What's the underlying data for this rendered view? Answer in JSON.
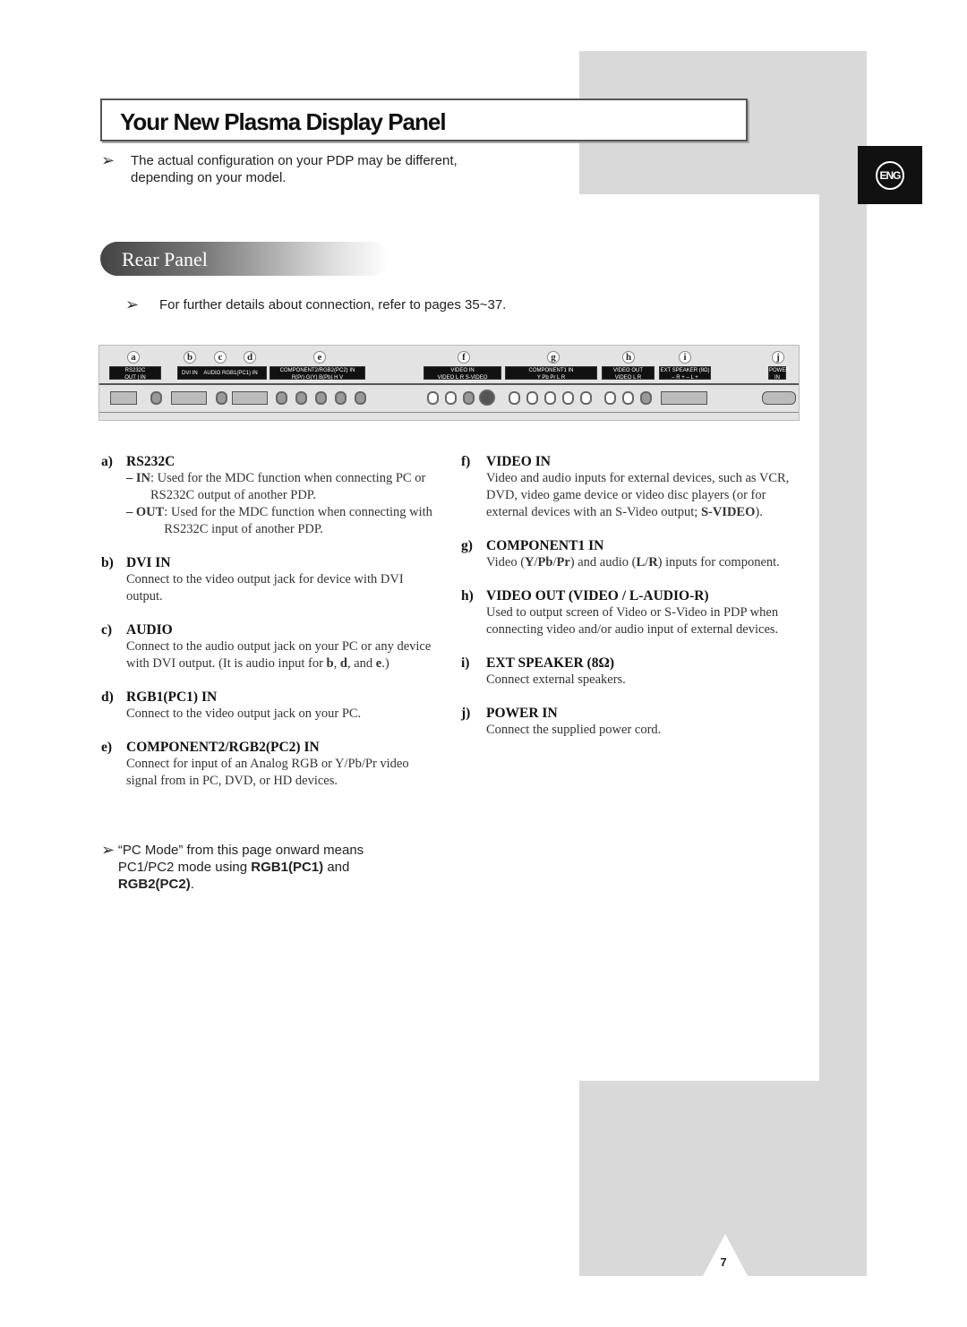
{
  "header": {
    "title": "Your New Plasma Display Panel",
    "lang_tab": "ENG"
  },
  "note_top": "The actual configuration on your PDP may be different, depending on your model.",
  "section": {
    "title": "Rear Panel",
    "note": "For further details about connection, refer to pages 35~37."
  },
  "diagram": {
    "letters": [
      "a",
      "b",
      "c",
      "d",
      "e",
      "f",
      "g",
      "h",
      "i",
      "j"
    ],
    "labels": {
      "rs232c": "RS232C",
      "out": "OUT",
      "in": "IN",
      "dvi": "DVI IN",
      "audio": "AUDIO",
      "rgb1": "RGB1(PC1) IN",
      "comp2": "COMPONENT2/RGB2(PC2) IN",
      "comp2_sub": "R(Pr)  G(Y)  B(Pb)  H  V",
      "videoin": "VIDEO IN",
      "videoin_sub": "VIDEO  L  R  S-VIDEO",
      "comp1": "COMPONENT1 IN",
      "comp1_sub": "Y  Pb  Pr  L  R",
      "videoout": "VIDEO OUT",
      "videoout_sub": "VIDEO  L  R",
      "ext": "EXT SPEAKER (8Ω)",
      "ext_sub": "– R +  – L +",
      "power": "POWER IN"
    }
  },
  "left_items": [
    {
      "key": "a)",
      "title": "RS232C",
      "subs": [
        {
          "dash": "– IN",
          "text": " : Used for the MDC function when connecting PC or RS232C output of another PDP."
        },
        {
          "dash": "– OUT",
          "text": " : Used for the MDC function when connecting with RS232C input of another PDP."
        }
      ]
    },
    {
      "key": "b)",
      "title": "DVI IN",
      "body": [
        {
          "t": "Connect to the video output jack for device with DVI output."
        }
      ]
    },
    {
      "key": "c)",
      "title": "AUDIO",
      "body": [
        {
          "t": "Connect to the audio output jack on your PC or any device with DVI output. (It is audio input for "
        },
        {
          "t": "b",
          "b": true
        },
        {
          "t": ", "
        },
        {
          "t": "d",
          "b": true
        },
        {
          "t": ", and "
        },
        {
          "t": "e",
          "b": true
        },
        {
          "t": ".)"
        }
      ]
    },
    {
      "key": "d)",
      "title": "RGB1(PC1) IN",
      "body": [
        {
          "t": "Connect to the video output jack on your PC."
        }
      ]
    },
    {
      "key": "e)",
      "title": "COMPONENT2/RGB2(PC2) IN",
      "body": [
        {
          "t": "Connect for input of an Analog RGB or Y/Pb/Pr video signal from in PC, DVD, or HD devices."
        }
      ]
    }
  ],
  "right_items": [
    {
      "key": "f)",
      "title": "VIDEO IN",
      "body": [
        {
          "t": "Video and audio inputs for external devices, such as VCR, DVD, video game device or video disc players (or for external devices with an S-Video output; "
        },
        {
          "t": "S-VIDEO",
          "b": true
        },
        {
          "t": ")."
        }
      ]
    },
    {
      "key": "g)",
      "title": "COMPONENT1 IN",
      "body": [
        {
          "t": "Video ("
        },
        {
          "t": "Y",
          "b": true
        },
        {
          "t": "/"
        },
        {
          "t": "Pb",
          "b": true
        },
        {
          "t": "/"
        },
        {
          "t": "Pr",
          "b": true
        },
        {
          "t": ") and audio ("
        },
        {
          "t": "L",
          "b": true
        },
        {
          "t": "/"
        },
        {
          "t": "R",
          "b": true
        },
        {
          "t": ") inputs for component."
        }
      ]
    },
    {
      "key": "h)",
      "title": "VIDEO OUT (VIDEO / L-AUDIO-R)",
      "body": [
        {
          "t": "Used to output screen of Video or S-Video in PDP when connecting video and/or audio input of external devices."
        }
      ]
    },
    {
      "key": "i)",
      "title": "EXT SPEAKER (8Ω)",
      "body": [
        {
          "t": "Connect external speakers."
        }
      ]
    },
    {
      "key": "j)",
      "title": "POWER IN",
      "body": [
        {
          "t": "Connect the supplied power cord."
        }
      ]
    }
  ],
  "note_bottom": [
    {
      "t": "“PC Mode” from this page onward means PC1/PC2 mode using "
    },
    {
      "t": "RGB1(PC1)",
      "b": true
    },
    {
      "t": " and "
    },
    {
      "t": "RGB2(PC2)",
      "b": true
    },
    {
      "t": "."
    }
  ],
  "page_number": "7"
}
